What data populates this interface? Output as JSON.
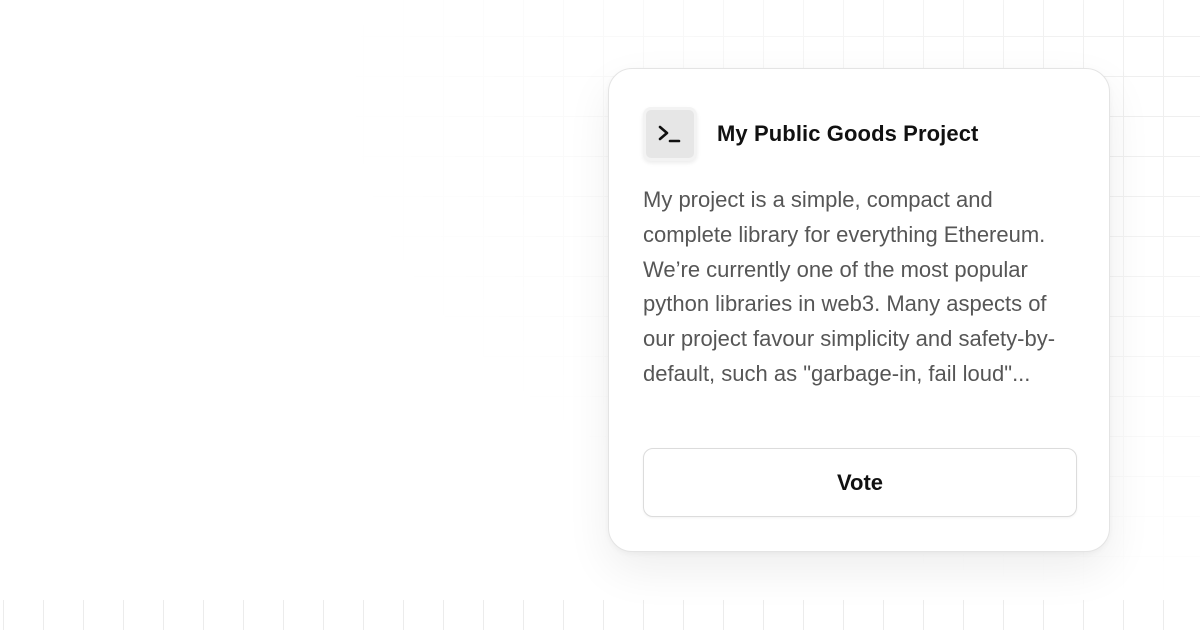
{
  "project": {
    "icon": "terminal-icon",
    "title": "My Public Goods Project",
    "description": "My project is a simple, compact and complete library for everything Ethereum. We’re currently one of the most popular python libraries in web3. Many aspects of our project favour simplicity and safety-by-default, such as \"garbage-in, fail loud\"...",
    "vote_label": "Vote"
  },
  "colors": {
    "background": "#ffffff",
    "card_border": "#e4e4e4",
    "icon_tile": "#e6e6e6",
    "title_text": "#111111",
    "body_text": "#565656"
  }
}
